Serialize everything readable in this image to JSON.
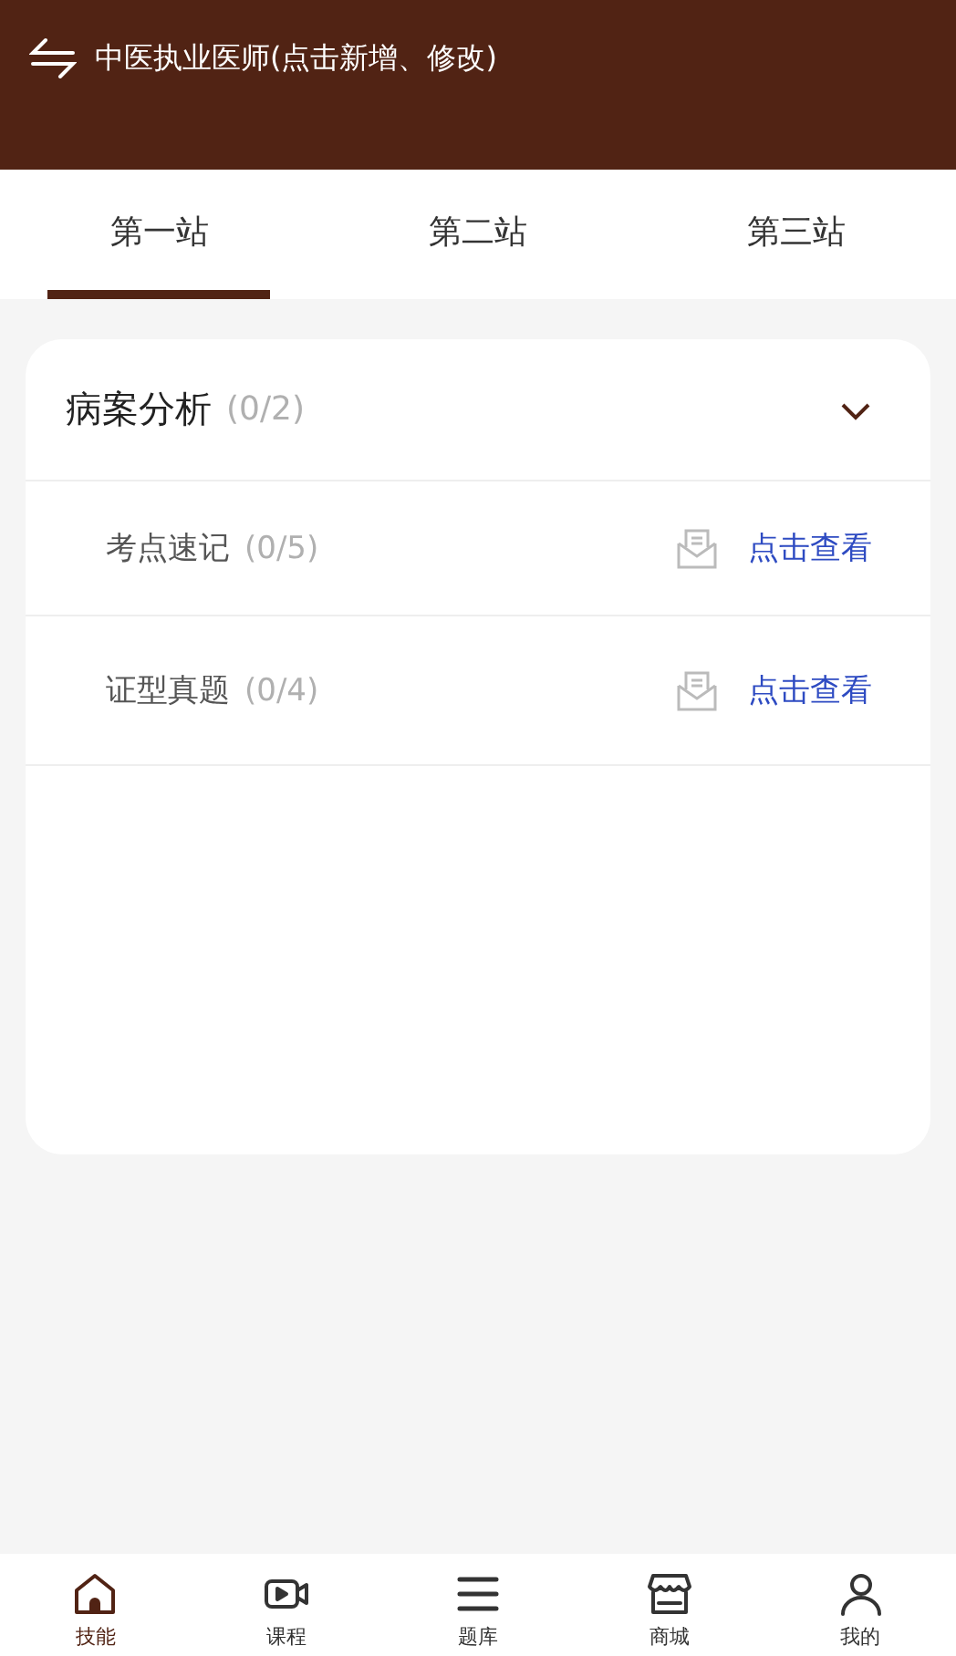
{
  "header": {
    "title": "中医执业医师(点击新增、修改)"
  },
  "tabs": [
    {
      "label": "第一站",
      "selected": true
    },
    {
      "label": "第二站",
      "selected": false
    },
    {
      "label": "第三站",
      "selected": false
    }
  ],
  "section": {
    "title": "病案分析",
    "count": "(0/2)",
    "expanded": true,
    "items": [
      {
        "title": "考点速记",
        "count": "(0/5)",
        "action": "点击查看"
      },
      {
        "title": "证型真题",
        "count": "(0/4)",
        "action": "点击查看"
      }
    ]
  },
  "bottom_nav": [
    {
      "kind": "home",
      "label": "技能",
      "selected": true
    },
    {
      "kind": "video",
      "label": "课程",
      "selected": false
    },
    {
      "kind": "list",
      "label": "题库",
      "selected": false
    },
    {
      "kind": "store",
      "label": "商城",
      "selected": false
    },
    {
      "kind": "user",
      "label": "我的",
      "selected": false
    }
  ]
}
